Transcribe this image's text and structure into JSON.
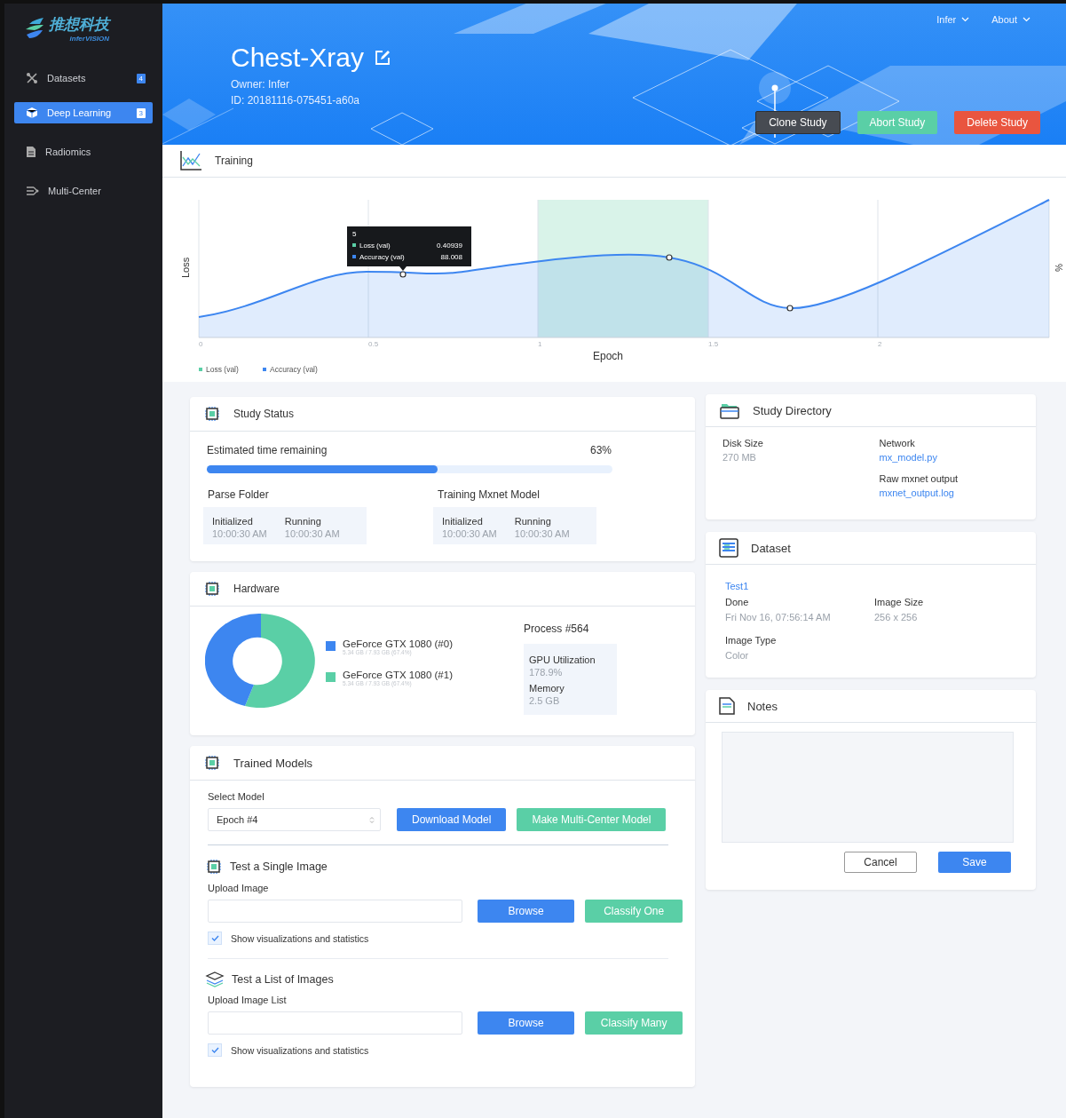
{
  "sidebar": {
    "logo": {
      "name": "推想科技",
      "tagline": "inferVISION"
    },
    "items": [
      {
        "label": "Datasets",
        "badge": "4",
        "selected": false
      },
      {
        "label": "Deep Learning",
        "badge": "3",
        "selected": true
      },
      {
        "label": "Radiomics",
        "selected": false
      },
      {
        "label": "Multi-Center",
        "selected": false
      }
    ]
  },
  "header": {
    "title": "Chest-Xray",
    "owner": "Owner: Infer",
    "id": "ID: 20181116-075451-a60a",
    "menus": [
      "Infer",
      "About"
    ],
    "buttons": [
      {
        "label": "Clone Study",
        "kind": "dark"
      },
      {
        "label": "Abort Study",
        "kind": "success"
      },
      {
        "label": "Delete Study",
        "kind": "danger"
      }
    ]
  },
  "training": {
    "title": "Training",
    "chart": {
      "ylabel": "Loss",
      "y2label": "%",
      "xlabel": "Epoch",
      "xticks": [
        "0",
        "0.5",
        "1",
        "1.5",
        "2"
      ],
      "legend": [
        {
          "label": "Loss (val)",
          "color": "#5acfa6"
        },
        {
          "label": "Accuracy (val)",
          "color": "#3d86f0"
        }
      ],
      "tooltip": {
        "title": "5",
        "rows": [
          {
            "label": "Loss (val)",
            "value": "0.40939",
            "color": "#5acfa6"
          },
          {
            "label": "Accuracy (val)",
            "value": "88.008",
            "color": "#3d86f0"
          }
        ]
      }
    }
  },
  "study_status": {
    "title": "Study Status",
    "progress": {
      "label": "Estimated time remaining",
      "reading": "63%",
      "level": 0.57
    },
    "stages": [
      {
        "name": "Parse Folder",
        "steps": [
          {
            "label": "Initialized",
            "time": "10:00:30 AM"
          },
          {
            "label": "Running",
            "time": "10:00:30 AM"
          }
        ]
      },
      {
        "name": "Training Mxnet Model",
        "steps": [
          {
            "label": "Initialized",
            "time": "10:00:30 AM"
          },
          {
            "label": "Running",
            "time": "10:00:30 AM"
          }
        ]
      }
    ]
  },
  "hardware": {
    "title": "Hardware",
    "gpus": [
      {
        "name": "GeForce GTX 1080 (#0)",
        "memory": "5.34 GB / 7.93 GB (67.4%)",
        "color": "#3d86f0"
      },
      {
        "name": "GeForce GTX 1080 (#1)",
        "memory": "5.34 GB / 7.93 GB (67.4%)",
        "color": "#5acfa6"
      }
    ],
    "process": {
      "title": "Process #564",
      "stats": [
        {
          "label": "GPU Utilization",
          "value": "178.9%"
        },
        {
          "label": "Memory",
          "value": "2.5 GB"
        }
      ]
    }
  },
  "trained_models": {
    "title": "Trained Models",
    "select_label": "Select Model",
    "select_value": "Epoch #4",
    "buttons": [
      {
        "label": "Download Model",
        "kind": "primary"
      },
      {
        "label": "Make Multi-Center Model",
        "kind": "success"
      }
    ],
    "tests": [
      {
        "title": "Test a Single Image",
        "upload_label": "Upload Image",
        "buttons": [
          {
            "label": "Browse",
            "kind": "primary"
          },
          {
            "label": "Classify One",
            "kind": "success"
          }
        ],
        "option": {
          "label": "Show visualizations and statistics",
          "checked": true
        }
      },
      {
        "title": "Test a List of Images",
        "upload_label": "Upload Image List",
        "buttons": [
          {
            "label": "Browse",
            "kind": "primary"
          },
          {
            "label": "Classify Many",
            "kind": "success"
          }
        ],
        "option": {
          "label": "Show visualizations and statistics",
          "checked": true
        }
      }
    ]
  },
  "study_directory": {
    "title": "Study Directory",
    "columns": [
      [
        {
          "label": "Disk Size",
          "value": "270 MB",
          "kind": "text"
        }
      ],
      [
        {
          "label": "Network",
          "value": "mx_model.py",
          "kind": "link"
        },
        {
          "label": "Raw mxnet output",
          "value": "mxnet_output.log",
          "kind": "link"
        }
      ]
    ]
  },
  "dataset": {
    "title": "Dataset",
    "name": "Test1",
    "fields": [
      {
        "label": "Done",
        "value": "Fri Nov 16, 07:56:14 AM"
      },
      {
        "label": "Image Size",
        "value": "256 x 256"
      },
      {
        "label": "Image Type",
        "value": "Color"
      }
    ]
  },
  "notes": {
    "title": "Notes",
    "buttons": [
      {
        "label": "Cancel",
        "kind": "default"
      },
      {
        "label": "Save",
        "kind": "primary"
      }
    ]
  }
}
